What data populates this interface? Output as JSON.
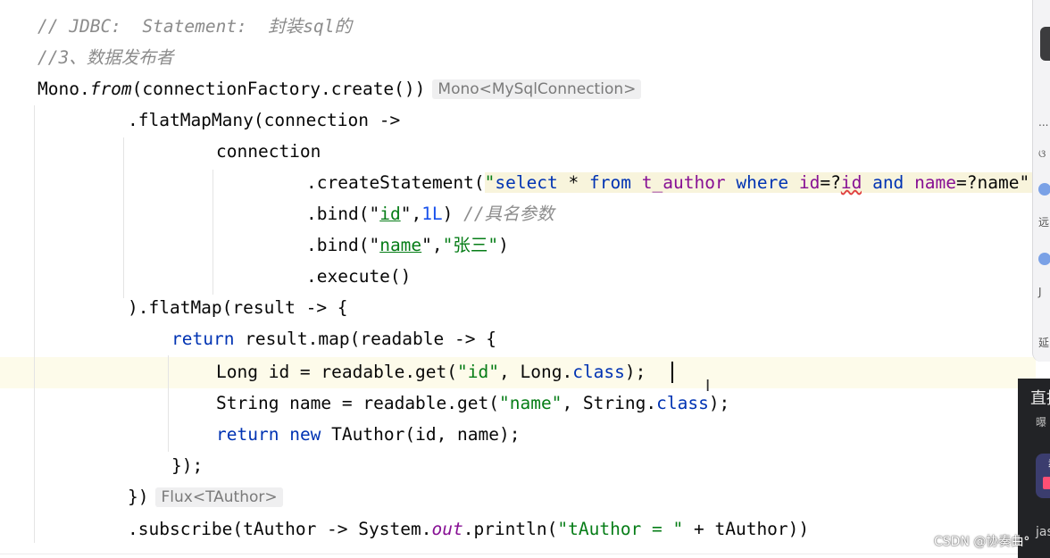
{
  "editor": {
    "lines": [
      {
        "parts": [
          {
            "t": "// JDBC:  Statement:  封装sql的",
            "cls": "cm"
          }
        ]
      },
      {
        "parts": [
          {
            "t": "//3、数据发布者",
            "cls": "cm"
          }
        ]
      },
      {
        "parts": [
          {
            "t": "Mono."
          },
          {
            "t": "from",
            "cls": "fnit"
          },
          {
            "t": "(connectionFactory.create())"
          }
        ],
        "hint": "Mono<MySqlConnection>"
      },
      {
        "parts": [
          {
            "t": ".flatMapMany(connection ->"
          }
        ]
      },
      {
        "parts": [
          {
            "t": "connection"
          }
        ]
      },
      {
        "parts": [
          {
            "t": ".createStatement("
          },
          {
            "t": "\"",
            "cls": "st sql-bg"
          },
          {
            "t": "select",
            "cls": "sqlkw sql-bg"
          },
          {
            "t": " * ",
            "cls": "sql-bg"
          },
          {
            "t": "from",
            "cls": "sqlkw sql-bg"
          },
          {
            "t": " ",
            "cls": "sql-bg"
          },
          {
            "t": "t_author",
            "cls": "sqlid sql-bg"
          },
          {
            "t": " ",
            "cls": "sql-bg"
          },
          {
            "t": "where",
            "cls": "sqlkw sql-bg"
          },
          {
            "t": " ",
            "cls": "sql-bg"
          },
          {
            "t": "id",
            "cls": "sqlid sql-bg"
          },
          {
            "t": "=?",
            "cls": "sql-bg"
          },
          {
            "t": "id",
            "cls": "sqlid sql-bg wavy"
          },
          {
            "t": " ",
            "cls": "sql-bg"
          },
          {
            "t": "and",
            "cls": "sqlkw sql-bg"
          },
          {
            "t": " ",
            "cls": "sql-bg"
          },
          {
            "t": "name",
            "cls": "sqlid sql-bg"
          },
          {
            "t": "=?name\");",
            "cls": "sql-bg"
          }
        ]
      },
      {
        "parts": [
          {
            "t": ".bind("
          },
          {
            "t": "\""
          },
          {
            "t": "id",
            "cls": "st uline"
          },
          {
            "t": "\""
          },
          {
            "t": ","
          },
          {
            "t": "1L",
            "cls": "num"
          },
          {
            "t": ") "
          },
          {
            "t": "//具名参数",
            "cls": "cm"
          }
        ]
      },
      {
        "parts": [
          {
            "t": ".bind("
          },
          {
            "t": "\""
          },
          {
            "t": "name",
            "cls": "st uline"
          },
          {
            "t": "\""
          },
          {
            "t": ","
          },
          {
            "t": "\"张三\"",
            "cls": "st"
          },
          {
            "t": ")"
          }
        ]
      },
      {
        "parts": [
          {
            "t": ".execute()"
          }
        ]
      },
      {
        "parts": [
          {
            "t": ").flatMap(result -> {"
          }
        ]
      },
      {
        "parts": [
          {
            "t": "return",
            "cls": "kw"
          },
          {
            "t": " result.map(readable -> {"
          }
        ]
      },
      {
        "parts": [
          {
            "t": "Long id = readable.get("
          },
          {
            "t": "\"id\"",
            "cls": "st"
          },
          {
            "t": ", Long."
          },
          {
            "t": "class",
            "cls": "kw"
          },
          {
            "t": ");"
          }
        ]
      },
      {
        "parts": [
          {
            "t": "String name = readable.get("
          },
          {
            "t": "\"name\"",
            "cls": "st"
          },
          {
            "t": ", String."
          },
          {
            "t": "class",
            "cls": "kw"
          },
          {
            "t": ");"
          }
        ]
      },
      {
        "parts": [
          {
            "t": "return",
            "cls": "kw"
          },
          {
            "t": " "
          },
          {
            "t": "new",
            "cls": "kw"
          },
          {
            "t": " TAuthor(id, name);"
          }
        ]
      },
      {
        "parts": [
          {
            "t": "});"
          }
        ]
      },
      {
        "parts": [
          {
            "t": "})"
          }
        ],
        "hint": "Flux<TAuthor>"
      },
      {
        "parts": [
          {
            "t": ".subscribe(tAuthor -> System."
          },
          {
            "t": "out",
            "cls": "it"
          },
          {
            "t": ".println("
          },
          {
            "t": "\"tAuthor = \"",
            "cls": "st"
          },
          {
            "t": " + tAuthor))"
          }
        ]
      }
    ]
  },
  "side_panel": {
    "items": [
      "...",
      "ଓ",
      "远",
      "J",
      "延"
    ]
  },
  "overlay": {
    "title": "直播",
    "subtitle": "曝",
    "label": "教",
    "footer": "jas"
  },
  "watermark": "CSDN @协奏曲°"
}
